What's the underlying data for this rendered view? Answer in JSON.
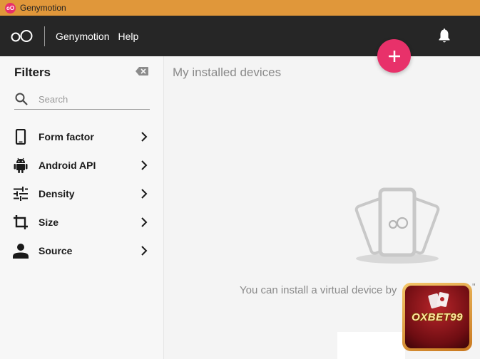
{
  "window": {
    "title": "Genymotion"
  },
  "header": {
    "logo_text": "oO",
    "nav": [
      "Genymotion",
      "Help"
    ],
    "notification_icon": "bell-icon"
  },
  "fab": {
    "icon": "plus-icon",
    "color": "#e8316a"
  },
  "sidebar": {
    "title": "Filters",
    "clear_icon": "backspace-icon",
    "search": {
      "placeholder": "Search",
      "value": ""
    },
    "items": [
      {
        "label": "Form factor",
        "icon": "phone-icon"
      },
      {
        "label": "Android API",
        "icon": "android-icon"
      },
      {
        "label": "Density",
        "icon": "tune-icon"
      },
      {
        "label": "Size",
        "icon": "crop-icon"
      },
      {
        "label": "Source",
        "icon": "person-icon"
      }
    ]
  },
  "main": {
    "title": "My installed devices",
    "empty_message": "You can install a virtual device by",
    "empty_message_suffix": "\""
  },
  "promo": {
    "text": "OXBET99"
  },
  "colors": {
    "title_bar": "#e0973a",
    "header": "#262626",
    "accent": "#e8316a"
  }
}
